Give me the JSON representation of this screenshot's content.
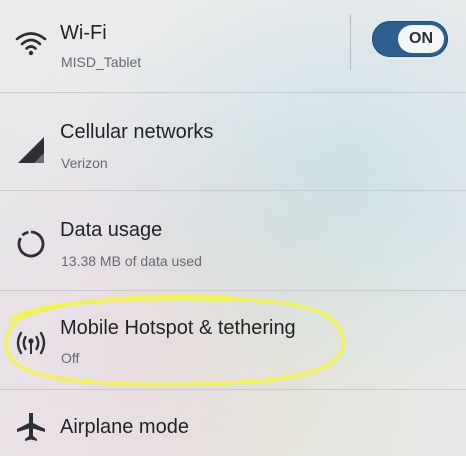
{
  "settings": {
    "wifi": {
      "title": "Wi-Fi",
      "subtitle": "MISD_Tablet",
      "toggle_label": "ON",
      "icon": "wifi-icon"
    },
    "cellular": {
      "title": "Cellular networks",
      "subtitle": "Verizon",
      "icon": "signal-icon"
    },
    "data_usage": {
      "title": "Data usage",
      "subtitle": "13.38 MB of data used",
      "icon": "data-usage-icon"
    },
    "hotspot": {
      "title": "Mobile Hotspot & tethering",
      "subtitle": "Off",
      "icon": "hotspot-icon"
    },
    "airplane": {
      "title": "Airplane mode",
      "icon": "airplane-icon"
    }
  },
  "colors": {
    "toggle_on": "#2a5f8f",
    "highlight": "#f2f24a"
  }
}
